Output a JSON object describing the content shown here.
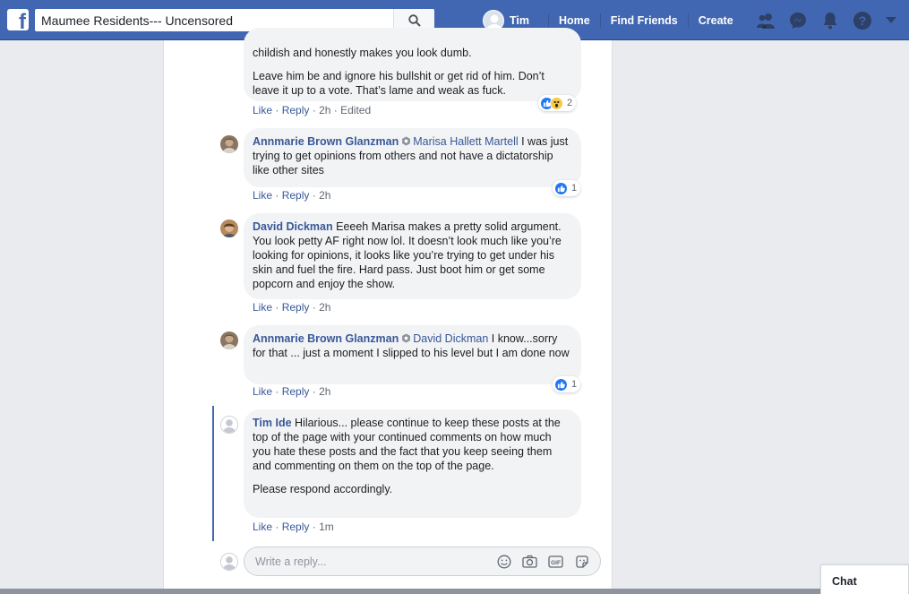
{
  "header": {
    "search_value": "Maumee Residents--- Uncensored",
    "user_name": "Tim",
    "nav": [
      "Home",
      "Find Friends",
      "Create"
    ]
  },
  "comments": [
    {
      "id": "c0",
      "paragraphs": [
        "childish and honestly makes you look dumb.",
        "Leave him be and ignore his bullshit or get rid of him. Don’t leave it up to a vote. That’s lame and weak as fuck."
      ],
      "actions": {
        "like": "Like",
        "reply": "Reply",
        "time": "2h",
        "edited": "Edited"
      },
      "reaction_count": "2"
    },
    {
      "id": "c1",
      "author": "Annmarie Brown Glanzman",
      "mention": "Marisa Hallett Martell",
      "text": "I was just trying to get opinions from others and not have a dictatorship like other sites",
      "actions": {
        "like": "Like",
        "reply": "Reply",
        "time": "2h"
      },
      "reaction_count": "1"
    },
    {
      "id": "c2",
      "author": "David Dickman",
      "text": "Eeeeh Marisa makes a pretty solid argument. You look petty AF right now lol. It doesn’t look much like you’re looking for opinions, it looks like you’re trying to get under his skin and fuel the fire. Hard pass. Just boot him or get some popcorn and enjoy the show.",
      "actions": {
        "like": "Like",
        "reply": "Reply",
        "time": "2h"
      }
    },
    {
      "id": "c3",
      "author": "Annmarie Brown Glanzman",
      "mention": "David Dickman",
      "text": "I know...sorry for that ... just a moment I slipped to his level but I am done now",
      "actions": {
        "like": "Like",
        "reply": "Reply",
        "time": "2h"
      },
      "reaction_count": "1"
    },
    {
      "id": "c4",
      "author": "Tim Ide",
      "paragraphs": [
        "Hilarious... please continue to keep these posts at the top of the page with your continued comments on how much you hate these posts and the fact that you keep seeing them and commenting on them on the top of the page.",
        "Please respond accordingly."
      ],
      "actions": {
        "like": "Like",
        "reply": "Reply",
        "time": "1m"
      }
    }
  ],
  "reply_box": {
    "placeholder": "Write a reply..."
  },
  "chat_label": "Chat",
  "colors": {
    "brand": "#4267b2",
    "link": "#385898",
    "bubble": "#f2f3f5",
    "like": "#2078f4"
  }
}
